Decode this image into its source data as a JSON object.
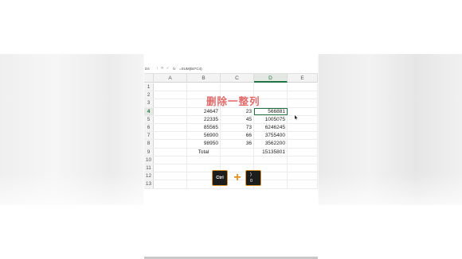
{
  "formula_bar": {
    "name_box": "D4",
    "icons": "⁝ ✕ ✓",
    "fx": "fx",
    "formula": "=SUM(B4*C4)"
  },
  "columns": [
    "A",
    "B",
    "C",
    "D",
    "E"
  ],
  "title": "删除一整列",
  "rows": [
    {
      "n": "1",
      "b": "",
      "c": "",
      "d": ""
    },
    {
      "n": "2",
      "b": "",
      "c": "",
      "d": ""
    },
    {
      "n": "3",
      "b": "",
      "c": "",
      "d": ""
    },
    {
      "n": "4",
      "b": "24647",
      "c": "23",
      "d": "566881"
    },
    {
      "n": "5",
      "b": "22335",
      "c": "45",
      "d": "1005075"
    },
    {
      "n": "6",
      "b": "85565",
      "c": "73",
      "d": "6246245"
    },
    {
      "n": "7",
      "b": "56900",
      "c": "66",
      "d": "3755400"
    },
    {
      "n": "8",
      "b": "98950",
      "c": "36",
      "d": "3562200"
    },
    {
      "n": "9",
      "b": "Total",
      "c": "",
      "d": "15135801"
    },
    {
      "n": "10",
      "b": "",
      "c": "",
      "d": ""
    },
    {
      "n": "11",
      "b": "",
      "c": "",
      "d": ""
    },
    {
      "n": "12",
      "b": "",
      "c": "",
      "d": ""
    },
    {
      "n": "13",
      "b": "",
      "c": "",
      "d": ""
    }
  ],
  "shortcut": {
    "key1": "Ctrl",
    "plus": "+",
    "key2_top": ")",
    "key2_bottom": "0"
  },
  "colors": {
    "accent": "#217346",
    "title": "#e06a6a",
    "key_border": "#d99a2b",
    "plus": "#e8901c"
  }
}
